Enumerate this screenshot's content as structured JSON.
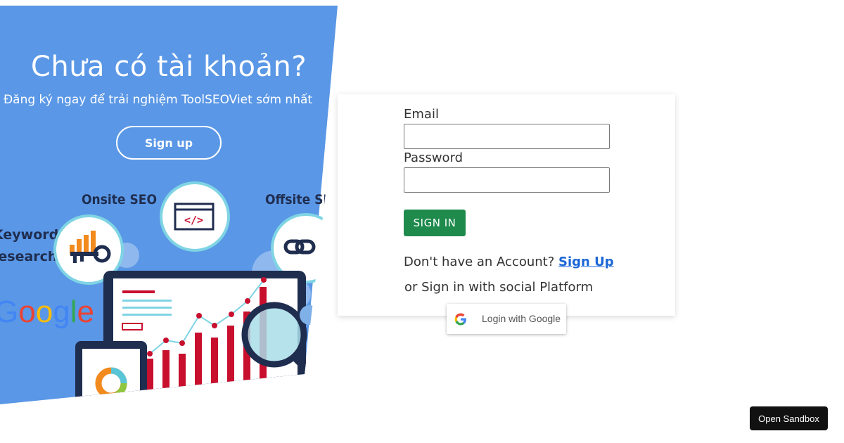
{
  "promo": {
    "title": "Chưa có tài khoản?",
    "subtitle": "Đăng ký ngay để trải nghiệm ToolSEOViet sớm nhất",
    "signup_label": "Sign up",
    "illustration": {
      "labels": {
        "onsite": "Onsite SEO",
        "offsite": "Offsite SEO",
        "keyword_line1": "Keyword",
        "keyword_line2": "research",
        "google": "Google",
        "code": "</>"
      },
      "colors": {
        "red": "#c8102e",
        "teal": "#5bc5d8",
        "orange": "#f28a1d",
        "navy": "#1f2d4f"
      }
    }
  },
  "login": {
    "email_label": "Email",
    "email_value": "",
    "password_label": "Password",
    "password_value": "",
    "signin_label": "SIGN IN",
    "no_account_text": "Don't have an Account?",
    "signup_link": "Sign Up",
    "social_text": "or Sign in with social Platform",
    "google_label": "Login with Google"
  },
  "sandbox": {
    "label": "Open Sandbox"
  },
  "colors": {
    "promo_bg": "#5a97e6",
    "signin_bg": "#1e8a4c",
    "link": "#1a66d6"
  }
}
